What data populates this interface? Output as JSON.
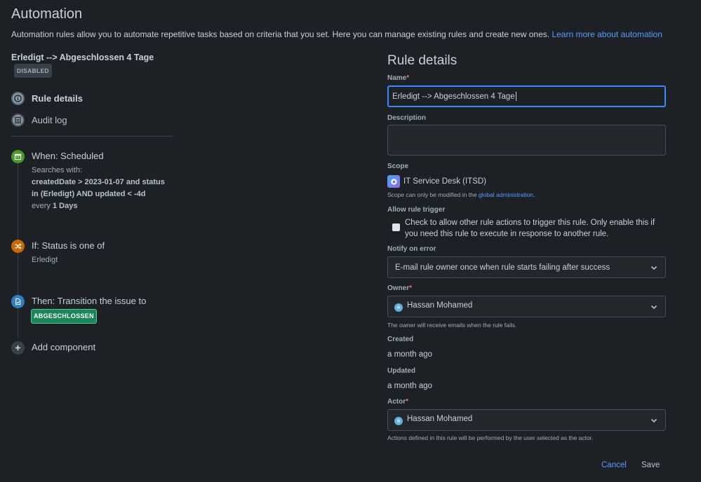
{
  "page": {
    "title": "Automation",
    "intro": "Automation rules allow you to automate repetitive tasks based on criteria that you set. Here you can manage existing rules and create new ones. ",
    "learn_more": "Learn more about automation"
  },
  "rule": {
    "name": "Erledigt --> Abgeschlossen 4 Tage",
    "status_badge": "DISABLED"
  },
  "nav": {
    "rule_details": "Rule details",
    "audit_log": "Audit log"
  },
  "components": {
    "when": {
      "title": "When: Scheduled",
      "searches_with": "Searches with:",
      "jql": "createdDate > 2023-01-07 and status in (Erledigt) AND updated < -4d",
      "every_prefix": "every",
      "every_value": "1 Days"
    },
    "if": {
      "title": "If: Status is one of",
      "value": "Erledigt"
    },
    "then": {
      "title": "Then: Transition the issue to",
      "lozenge": "ABGESCHLOSSEN"
    },
    "add": "Add component"
  },
  "details": {
    "title": "Rule details",
    "name_label": "Name",
    "name_value": "Erledigt --> Abgeschlossen 4 Tage",
    "description_label": "Description",
    "description_value": "",
    "scope_label": "Scope",
    "scope_value": "IT Service Desk (ITSD)",
    "scope_help_prefix": "Scope can only be modified in the ",
    "scope_help_link": "global administration",
    "scope_help_suffix": ".",
    "allow_trigger_label": "Allow rule trigger",
    "allow_trigger_text": "Check to allow other rule actions to trigger this rule. Only enable this if you need this rule to execute in response to another rule.",
    "allow_trigger_checked": false,
    "notify_label": "Notify on error",
    "notify_value": "E-mail rule owner once when rule starts failing after success",
    "owner_label": "Owner",
    "owner_value": "Hassan Mohamed",
    "owner_help": "The owner will receive emails when the rule fails.",
    "created_label": "Created",
    "created_value": "a month ago",
    "updated_label": "Updated",
    "updated_value": "a month ago",
    "actor_label": "Actor",
    "actor_value": "Hassan Mohamed",
    "actor_help": "Actions defined in this rule will be performed by the user selected as the actor.",
    "required_mark": "*"
  },
  "actions": {
    "cancel": "Cancel",
    "save": "Save"
  },
  "colors": {
    "background": "#1d2125",
    "link": "#579dff",
    "when_icon": "#4c9a2a",
    "if_icon": "#c66a07",
    "then_icon": "#2f7ec4",
    "focus_border": "#388bff",
    "lozenge_green": "#1f845a"
  },
  "icons": {
    "rule_details": "info-icon",
    "audit_log": "list-icon",
    "when": "calendar-icon",
    "if": "shuffle-icon",
    "then": "document-icon",
    "add": "plus-icon",
    "scope": "project-avatar-icon",
    "select": "chevron-down-icon",
    "avatar": "emoji-avatar-icon"
  }
}
